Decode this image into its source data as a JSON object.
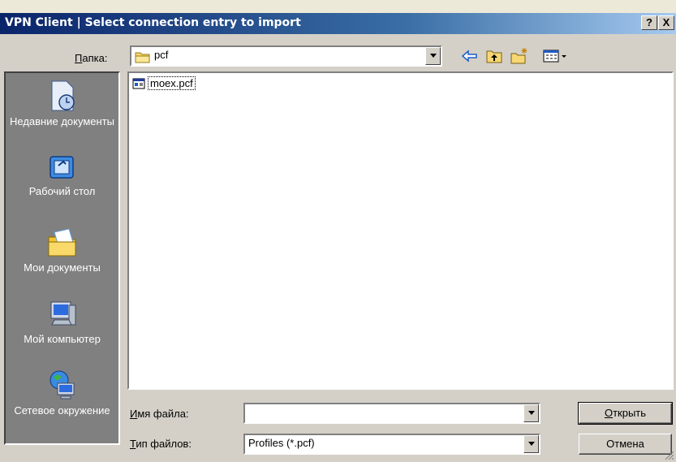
{
  "window": {
    "title": "VPN Client  |  Select connection entry to import",
    "help_label": "?",
    "close_label": "X"
  },
  "look_in": {
    "label_accel": "П",
    "label_rest": "апка:",
    "value": "pcf"
  },
  "toolbar": {
    "back_icon": "back-arrow-icon",
    "up_icon": "up-folder-icon",
    "new_folder_icon": "new-folder-icon",
    "view_icon": "view-menu-icon"
  },
  "places": [
    {
      "label": "Недавние документы",
      "icon": "recent-documents-icon"
    },
    {
      "label": "Рабочий стол",
      "icon": "desktop-icon"
    },
    {
      "label": "Мои документы",
      "icon": "my-documents-icon"
    },
    {
      "label": "Мой компьютер",
      "icon": "my-computer-icon"
    },
    {
      "label": "Сетевое окружение",
      "icon": "network-places-icon"
    }
  ],
  "files": [
    {
      "name": "moex.pcf",
      "icon": "pcf-file-icon"
    }
  ],
  "file_name": {
    "label_accel": "И",
    "label_rest": "мя файла:",
    "value": ""
  },
  "file_type": {
    "label_accel": "Т",
    "label_rest": "ип файлов:",
    "value": "Profiles (*.pcf)"
  },
  "buttons": {
    "open_accel": "О",
    "open_rest": "ткрыть",
    "cancel": "Отмена"
  },
  "colors": {
    "title_start": "#0a246a",
    "title_end": "#a6caf0",
    "face": "#d4d0c8",
    "places_bg": "#808080"
  }
}
